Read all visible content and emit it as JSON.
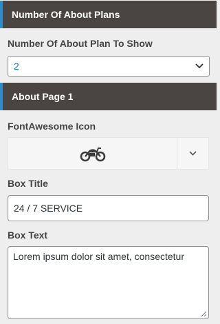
{
  "sections": {
    "plans_header": "Number Of About Plans",
    "about_page_header": "About Page 1"
  },
  "plans_count": {
    "label": "Number Of About Plan To Show",
    "selected_value": "2",
    "toggle_icon": "chevron-down-icon"
  },
  "icon_field": {
    "label": "FontAwesome Icon",
    "selected_icon": "motorcycle-icon",
    "toggle_icon": "chevron-down-icon"
  },
  "box_title": {
    "label": "Box Title",
    "value": "24 / 7 SERVICE"
  },
  "box_text": {
    "label": "Box Text",
    "value": "Lorem ipsum dolor sit amet, consectetur"
  },
  "colors": {
    "header_bg": "#4a4542",
    "header_accent": "#2e8bc7",
    "select_text": "#2271b1",
    "page_bg": "#eeeeee"
  }
}
